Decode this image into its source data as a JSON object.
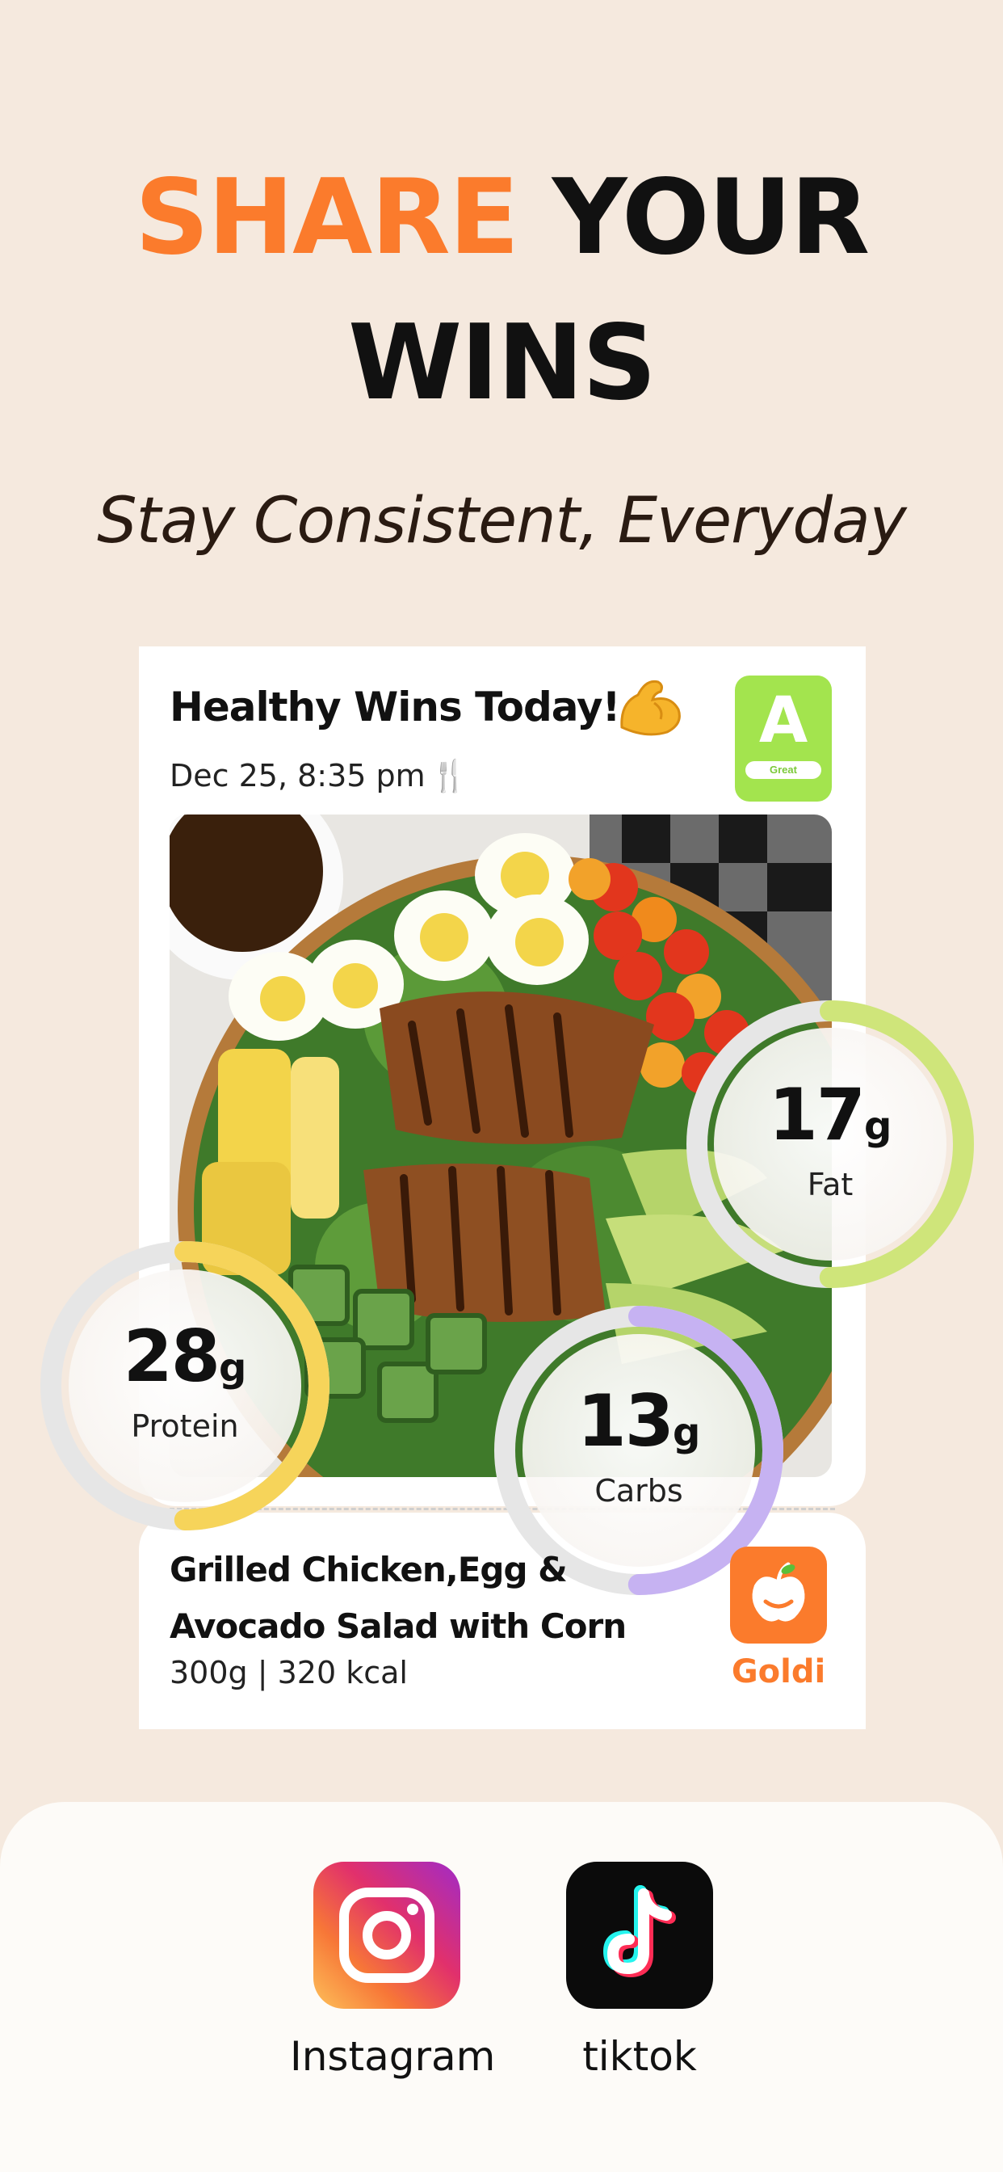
{
  "headline": {
    "accent": "SHARE",
    "rest": " YOUR",
    "line2": "WINS"
  },
  "subtitle": "Stay Consistent, Everyday",
  "card": {
    "title": "Healthy Wins Today!",
    "date": "Dec 25, 8:35 pm",
    "grade": {
      "letter": "A",
      "label": "Great",
      "color": "#a3e44e"
    },
    "photo_alt": "Grilled Chicken, Egg and Avocado Salad"
  },
  "macros": [
    {
      "key": "fat",
      "value": "17",
      "unit": "g",
      "label": "Fat",
      "progress": 0.5,
      "color": "#cfe57a"
    },
    {
      "key": "protein",
      "value": "28",
      "unit": "g",
      "label": "Protein",
      "progress": 0.5,
      "color": "#f6d45a"
    },
    {
      "key": "carbs",
      "value": "13",
      "unit": "g",
      "label": "Carbs",
      "progress": 0.5,
      "color": "#c6b2f2"
    }
  ],
  "meal": {
    "name_line1": "Grilled Chicken,Egg &",
    "name_line2": "Avocado Salad with Corn",
    "meta": "300g | 320 kcal",
    "brand": "Goldi"
  },
  "share": {
    "apps": [
      {
        "name": "Instagram",
        "icon": "instagram-icon"
      },
      {
        "name": "tiktok",
        "icon": "tiktok-icon"
      }
    ]
  },
  "colors": {
    "accent": "#fb7b2c",
    "background": "#f5e9de"
  }
}
